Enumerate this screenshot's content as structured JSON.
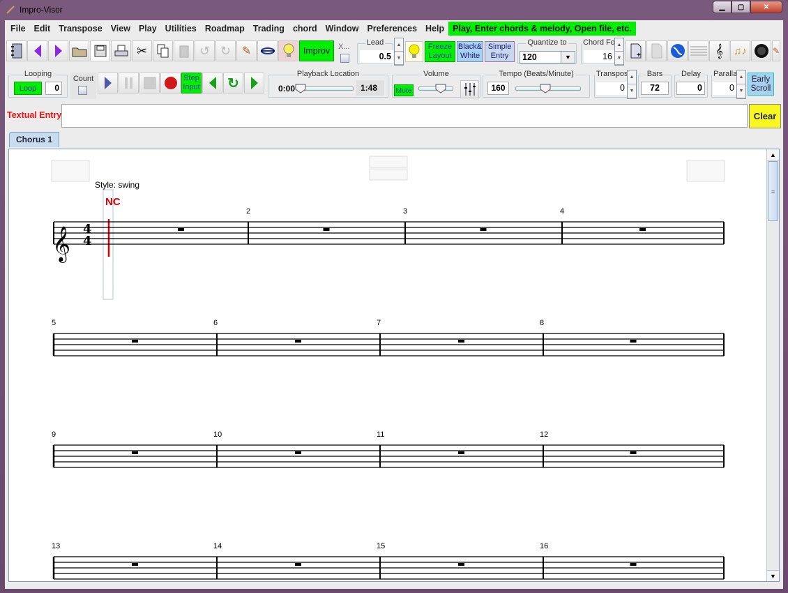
{
  "window": {
    "title": "Impro-Visor",
    "buttons": [
      "minimize",
      "maximize",
      "close"
    ]
  },
  "menubar": {
    "items": [
      "File",
      "Edit",
      "Transpose",
      "View",
      "Play",
      "Utilities",
      "Roadmap",
      "Trading",
      "chord",
      "Window",
      "Preferences",
      "Help"
    ],
    "hint": "Play, Enter chords & melody, Open file, etc."
  },
  "toolbar1": {
    "icons": [
      "notebook-icon",
      "prev-chorus-icon",
      "next-chorus-icon",
      "open-folder-icon",
      "save-icon",
      "print-icon",
      "cut-icon",
      "copy-icon",
      "paste-icon",
      "undo-icon",
      "redo-icon",
      "pencil-icon",
      "expand-icon",
      "lightbulb-icon"
    ],
    "improv_label": "Improv",
    "x_label": "X...",
    "lead": {
      "label": "Lead",
      "value": "0.5"
    },
    "freeze_layout": "Freeze Layout",
    "black_white": "Black& White",
    "simple_entry": "Simple Entry",
    "quantize": {
      "label": "Quantize to",
      "value": "120"
    },
    "chord_font": {
      "label": "Chord Fo",
      "value": "16"
    },
    "right_icons": [
      "new-leadsheet-icon",
      "blank-page-icon",
      "globe-icon",
      "lick-generator-icon",
      "treble-clef-icon",
      "style-editor-icon",
      "midi-icon",
      "pencil-icon"
    ]
  },
  "toolbar2": {
    "looping": {
      "label": "Looping",
      "button": "Loop",
      "value": "0"
    },
    "count": {
      "label": "Count",
      "checked": false
    },
    "step_input": "Step Input",
    "playback": {
      "label": "Playback Location",
      "start": "0:00",
      "end": "1:48",
      "position": 0.0
    },
    "volume": {
      "label": "Volume",
      "mute": "Mute",
      "level": 0.7
    },
    "tempo": {
      "label": "Tempo (Beats/Minute)",
      "value": "160",
      "level": 0.45
    },
    "transpose": {
      "label": "Transpos",
      "value": "0"
    },
    "bars": {
      "label": "Bars",
      "value": "72"
    },
    "delay": {
      "label": "Delay",
      "value": "0"
    },
    "parallax": {
      "label": "Paralla",
      "value": "0"
    },
    "early_scroll": "Early Scroll"
  },
  "textual_entry": {
    "label": "Textual Entry",
    "value": "",
    "clear": "Clear"
  },
  "tabs": [
    {
      "label": "Chorus 1",
      "active": true
    }
  ],
  "score": {
    "style_label": "Style: swing",
    "first_chord": "NC",
    "time_signature": [
      "4",
      "4"
    ],
    "measure_numbers": [
      "2",
      "3",
      "4",
      "5",
      "6",
      "7",
      "8",
      "9",
      "10",
      "11",
      "12",
      "13",
      "14",
      "15",
      "16"
    ],
    "accent_color": "#dd0000"
  }
}
